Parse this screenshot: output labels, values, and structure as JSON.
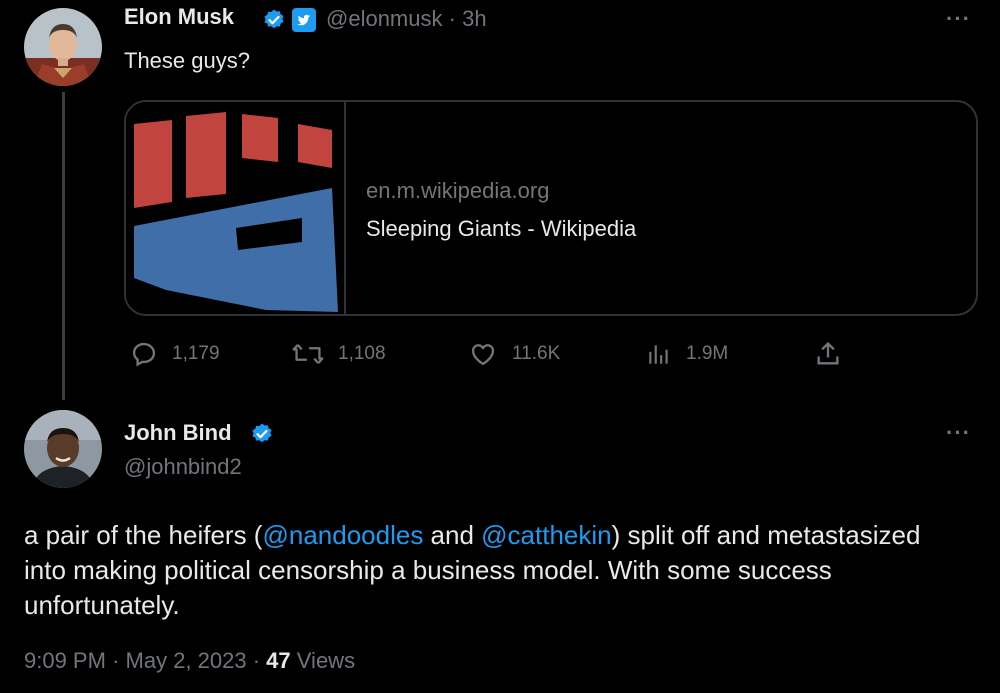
{
  "tweet1": {
    "author_name": "Elon Musk",
    "handle": "@elonmusk",
    "separator": "·",
    "time": "3h",
    "text": "These guys?",
    "card": {
      "domain": "en.m.wikipedia.org",
      "title": "Sleeping Giants - Wikipedia"
    },
    "actions": {
      "replies": "1,179",
      "retweets": "1,108",
      "likes": "11.6K",
      "views": "1.9M"
    }
  },
  "tweet2": {
    "author_name": "John Bind",
    "handle": "@johnbind2",
    "text_parts": {
      "p1": "a pair of the heifers (",
      "mention1": "@nandoodles",
      "p2": " and ",
      "mention2": "@catthekin",
      "p3": ") split off and metastasized into making political censorship a business model. With some success unfortunately."
    },
    "time": "9:09 PM",
    "sep1": "·",
    "date": "May 2, 2023",
    "sep2": "·",
    "views_count": "47",
    "views_label": "Views"
  },
  "colors": {
    "background": "#000000",
    "text": "#e7e9ea",
    "muted": "#71767b",
    "accent": "#1d9bf0",
    "fist_red": "#c1443f",
    "fist_blue": "#3f6ea8"
  },
  "icons": {
    "verified": "verified-badge-icon",
    "bird": "twitter-bird-icon",
    "reply": "reply-icon",
    "retweet": "retweet-icon",
    "like": "heart-icon",
    "views": "analytics-icon",
    "share": "share-icon",
    "more": "more-icon"
  }
}
